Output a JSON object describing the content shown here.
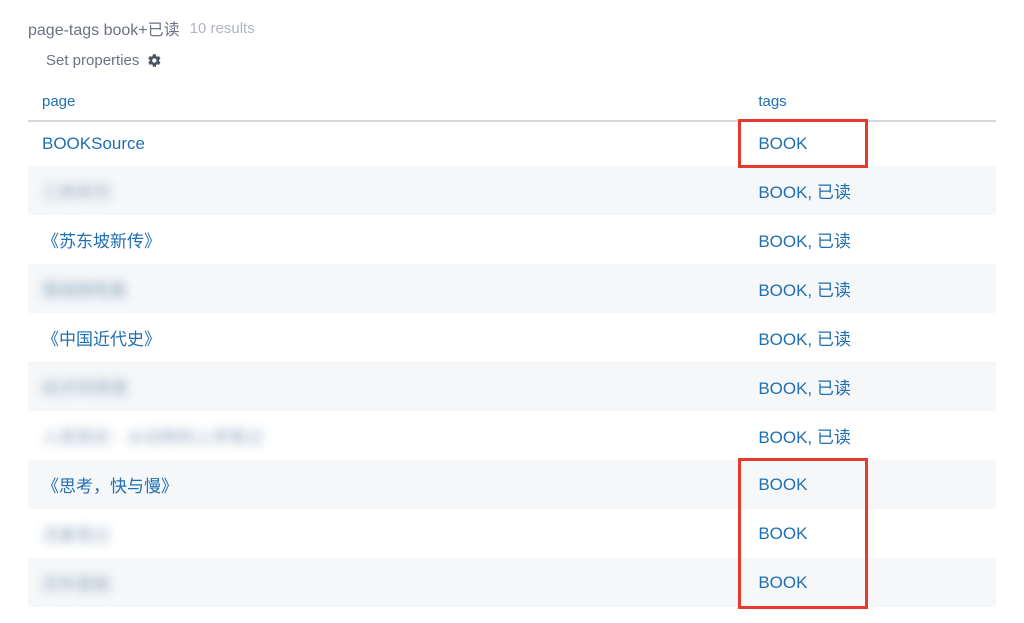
{
  "header": {
    "query_title": "page-tags book+已读",
    "result_count": "10 results"
  },
  "toolbar": {
    "set_properties_label": "Set properties"
  },
  "columns": {
    "page": "page",
    "tags": "tags"
  },
  "rows": [
    {
      "page": "BOOKSource",
      "blurred": false,
      "tags": "BOOK",
      "highlight": "top"
    },
    {
      "page": "三体系列",
      "blurred": true,
      "tags": "BOOK, 已读",
      "highlight": "none"
    },
    {
      "page": "《苏东坡新传》",
      "blurred": false,
      "tags": "BOOK, 已读",
      "highlight": "none"
    },
    {
      "page": "围城随笔集",
      "blurred": true,
      "tags": "BOOK, 已读",
      "highlight": "none"
    },
    {
      "page": "《中国近代史》",
      "blurred": false,
      "tags": "BOOK, 已读",
      "highlight": "none"
    },
    {
      "page": "经济学原理",
      "blurred": true,
      "tags": "BOOK, 已读",
      "highlight": "none"
    },
    {
      "page": "人类简史：从动物到上帝笔记",
      "blurred": true,
      "tags": "BOOK, 已读",
      "highlight": "none"
    },
    {
      "page": "《思考，快与慢》",
      "blurred": false,
      "tags": "BOOK",
      "highlight": "bottom"
    },
    {
      "page": "活着笔记",
      "blurred": true,
      "tags": "BOOK",
      "highlight": "bottom"
    },
    {
      "page": "百年孤独",
      "blurred": true,
      "tags": "BOOK",
      "highlight": "bottom"
    }
  ]
}
